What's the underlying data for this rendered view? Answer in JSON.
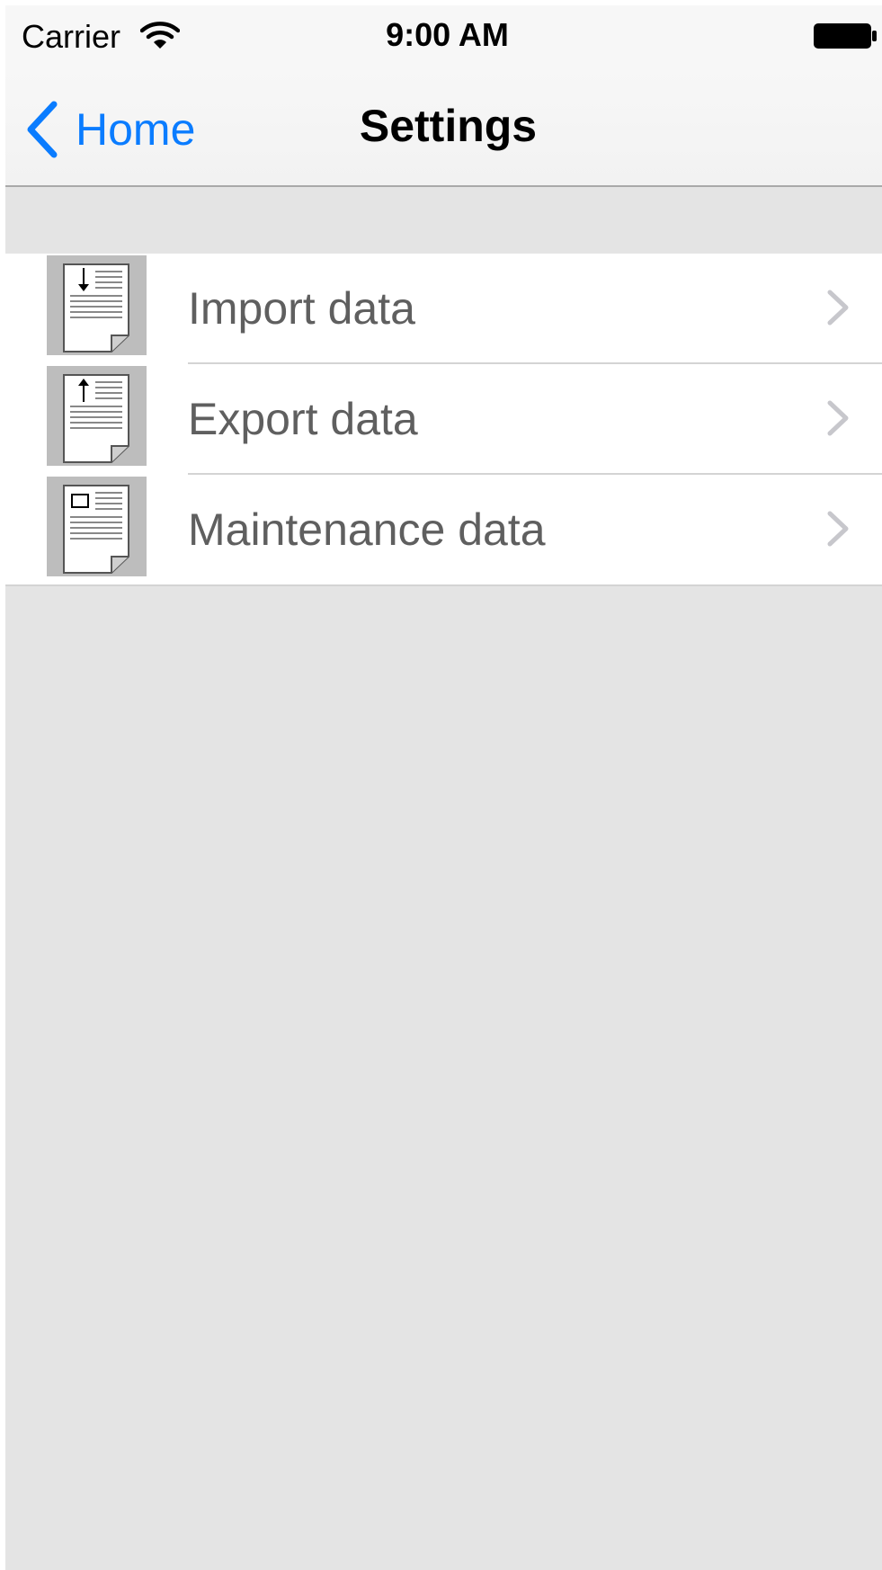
{
  "status_bar": {
    "carrier": "Carrier",
    "time": "9:00 AM",
    "wifi_icon": "wifi-icon",
    "battery_icon": "battery-full-icon"
  },
  "nav_bar": {
    "back_label": "Home",
    "back_icon": "chevron-left-icon",
    "title": "Settings"
  },
  "settings": {
    "items": [
      {
        "label": "Import data",
        "icon": "document-import-icon"
      },
      {
        "label": "Export data",
        "icon": "document-export-icon"
      },
      {
        "label": "Maintenance data",
        "icon": "document-maintenance-icon"
      }
    ]
  },
  "colors": {
    "accent": "#0a7cff",
    "background": "#e4e4e4",
    "row_text": "#5f5f5f",
    "chevron": "#c7c7cc"
  }
}
